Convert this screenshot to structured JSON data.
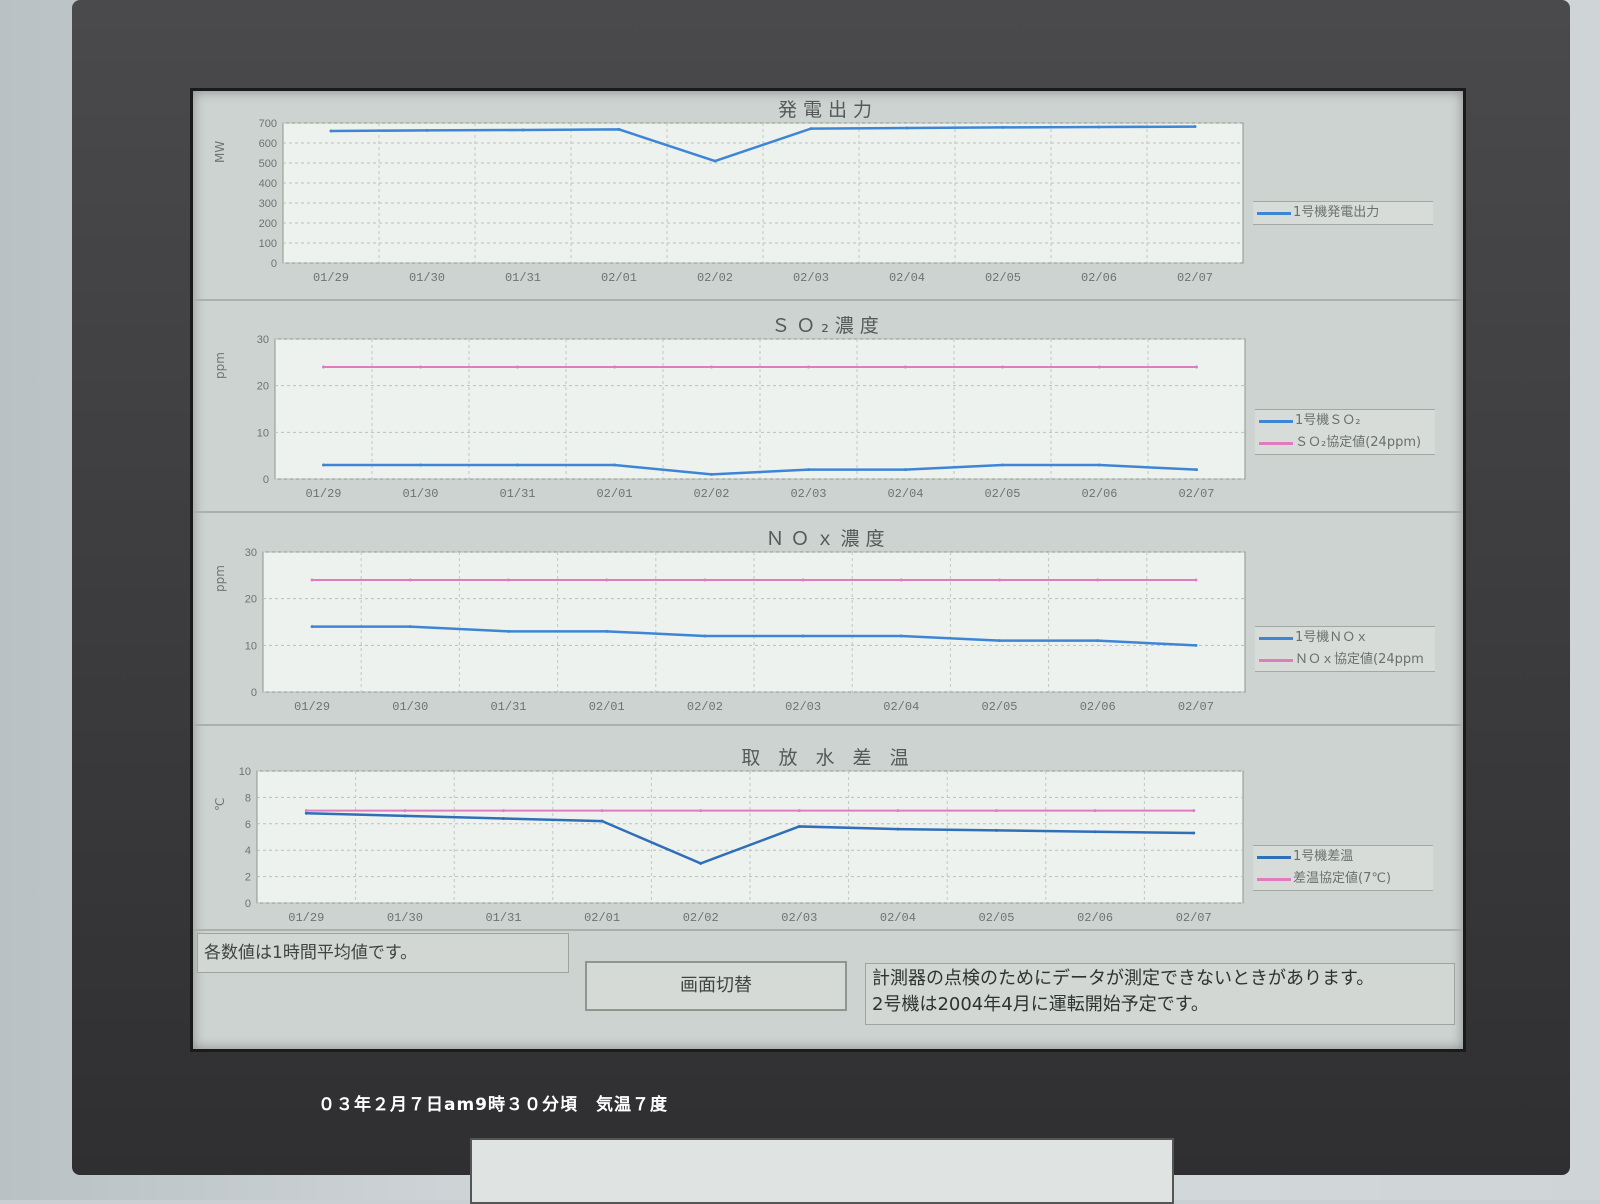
{
  "panels": [
    {
      "title": "発電出力",
      "unit": "MW",
      "yticks": [
        "700",
        "600",
        "500",
        "400",
        "300",
        "200",
        "100",
        "0"
      ],
      "xticks": [
        "01/29",
        "01/30",
        "01/31",
        "02/01",
        "02/02",
        "02/03",
        "02/04",
        "02/05",
        "02/06",
        "02/07"
      ],
      "legend": [
        {
          "label": "1号機発電出力",
          "color": "#3d86d6"
        }
      ]
    },
    {
      "title": "ＳＯ₂濃度",
      "unit": "ppm",
      "yticks": [
        "30",
        "20",
        "10",
        "0"
      ],
      "xticks": [
        "01/29",
        "01/30",
        "01/31",
        "02/01",
        "02/02",
        "02/03",
        "02/04",
        "02/05",
        "02/06",
        "02/07"
      ],
      "legend": [
        {
          "label": "1号機ＳＯ₂",
          "color": "#3d86d6"
        },
        {
          "label": "ＳＯ₂協定値(24ppm)",
          "color": "#e07bc0"
        }
      ]
    },
    {
      "title": "ＮＯｘ濃度",
      "unit": "ppm",
      "yticks": [
        "30",
        "20",
        "10",
        "0"
      ],
      "xticks": [
        "01/29",
        "01/30",
        "01/31",
        "02/01",
        "02/02",
        "02/03",
        "02/04",
        "02/05",
        "02/06",
        "02/07"
      ],
      "legend": [
        {
          "label": "1号機ＮＯｘ",
          "color": "#3d86d6"
        },
        {
          "label": "ＮＯｘ協定値(24ppm",
          "color": "#e07bc0"
        }
      ]
    },
    {
      "title": "取 放 水 差 温",
      "unit": "℃",
      "yticks": [
        "10",
        "8",
        "6",
        "4",
        "2",
        "0"
      ],
      "xticks": [
        "01/29",
        "01/30",
        "01/31",
        "02/01",
        "02/02",
        "02/03",
        "02/04",
        "02/05",
        "02/06",
        "02/07"
      ],
      "legend": [
        {
          "label": "1号機差温",
          "color": "#2f6fb8"
        },
        {
          "label": "差温協定値(7℃)",
          "color": "#e07bc0"
        }
      ]
    }
  ],
  "chart_data": [
    {
      "type": "line",
      "title": "発電出力",
      "ylabel": "MW",
      "ylim": [
        0,
        700
      ],
      "x": [
        "01/29",
        "01/30",
        "01/31",
        "02/01",
        "02/02",
        "02/03",
        "02/04",
        "02/05",
        "02/06",
        "02/07"
      ],
      "series": [
        {
          "name": "1号機発電出力",
          "values": [
            660,
            663,
            665,
            668,
            510,
            672,
            675,
            678,
            680,
            682
          ]
        }
      ]
    },
    {
      "type": "line",
      "title": "ＳＯ₂濃度",
      "ylabel": "ppm",
      "ylim": [
        0,
        30
      ],
      "x": [
        "01/29",
        "01/30",
        "01/31",
        "02/01",
        "02/02",
        "02/03",
        "02/04",
        "02/05",
        "02/06",
        "02/07"
      ],
      "series": [
        {
          "name": "1号機ＳＯ₂",
          "values": [
            3,
            3,
            3,
            3,
            1,
            2,
            2,
            3,
            3,
            2
          ]
        },
        {
          "name": "ＳＯ₂協定値(24ppm)",
          "values": [
            24,
            24,
            24,
            24,
            24,
            24,
            24,
            24,
            24,
            24
          ]
        }
      ]
    },
    {
      "type": "line",
      "title": "ＮＯｘ濃度",
      "ylabel": "ppm",
      "ylim": [
        0,
        30
      ],
      "x": [
        "01/29",
        "01/30",
        "01/31",
        "02/01",
        "02/02",
        "02/03",
        "02/04",
        "02/05",
        "02/06",
        "02/07"
      ],
      "series": [
        {
          "name": "1号機ＮＯｘ",
          "values": [
            14,
            14,
            13,
            13,
            12,
            12,
            12,
            11,
            11,
            10
          ]
        },
        {
          "name": "ＮＯｘ協定値(24ppm",
          "values": [
            24,
            24,
            24,
            24,
            24,
            24,
            24,
            24,
            24,
            24
          ]
        }
      ]
    },
    {
      "type": "line",
      "title": "取 放 水 差 温",
      "ylabel": "℃",
      "ylim": [
        0,
        10
      ],
      "x": [
        "01/29",
        "01/30",
        "01/31",
        "02/01",
        "02/02",
        "02/03",
        "02/04",
        "02/05",
        "02/06",
        "02/07"
      ],
      "series": [
        {
          "name": "1号機差温",
          "values": [
            6.8,
            6.6,
            6.4,
            6.2,
            3.0,
            5.8,
            5.6,
            5.5,
            5.4,
            5.3
          ]
        },
        {
          "name": "差温協定値(7℃)",
          "values": [
            7,
            7,
            7,
            7,
            7,
            7,
            7,
            7,
            7,
            7
          ]
        }
      ]
    }
  ],
  "footer": {
    "note_left": "各数値は1時間平均値です。",
    "switch_button": "画面切替",
    "note_right_1": "計測器の点検のためにデータが測定できないときがあります。",
    "note_right_2": "2号機は2004年4月に運転開始予定です。"
  },
  "caption": "０３年２月７日am9時３０分頃　気温７度"
}
